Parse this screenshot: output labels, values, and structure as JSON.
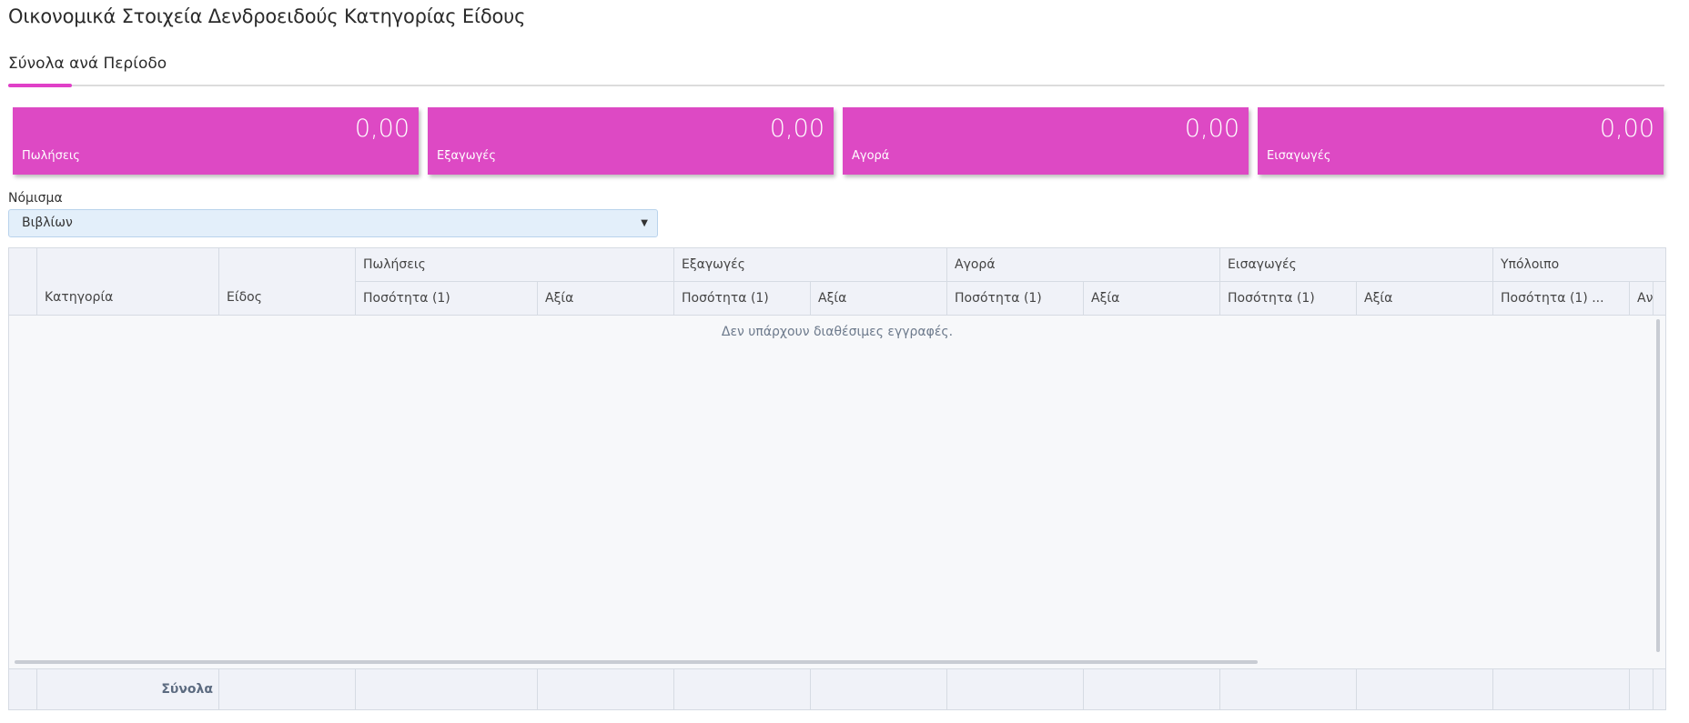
{
  "page": {
    "title": "Οικονομικά Στοιχεία Δενδροειδούς Κατηγορίας Είδους"
  },
  "tabs": {
    "active": "Σύνολα ανά Περίοδο"
  },
  "cards": [
    {
      "value": "0,00",
      "label": "Πωλήσεις"
    },
    {
      "value": "0,00",
      "label": "Εξαγωγές"
    },
    {
      "value": "0,00",
      "label": "Αγορά"
    },
    {
      "value": "0,00",
      "label": "Εισαγωγές"
    }
  ],
  "currency": {
    "label": "Νόμισμα",
    "value": "Βιβλίων"
  },
  "grid": {
    "columns": {
      "category": "Κατηγορία",
      "item": "Είδος"
    },
    "groups": [
      "Πωλήσεις",
      "Εξαγωγές",
      "Αγορά",
      "Εισαγωγές",
      "Υπόλοιπο"
    ],
    "sub": {
      "qty": "Ποσότητα (1)",
      "value": "Αξία",
      "qty_truncated": "Ποσότητα (1) ...",
      "value_truncated": "Αν"
    },
    "empty": "Δεν υπάρχουν διαθέσιμες εγγραφές.",
    "totals_label": "Σύνολα"
  },
  "colors": {
    "accent": "#dd49c4",
    "tab_underline": "#e040c8",
    "select_bg": "#e3effa"
  }
}
